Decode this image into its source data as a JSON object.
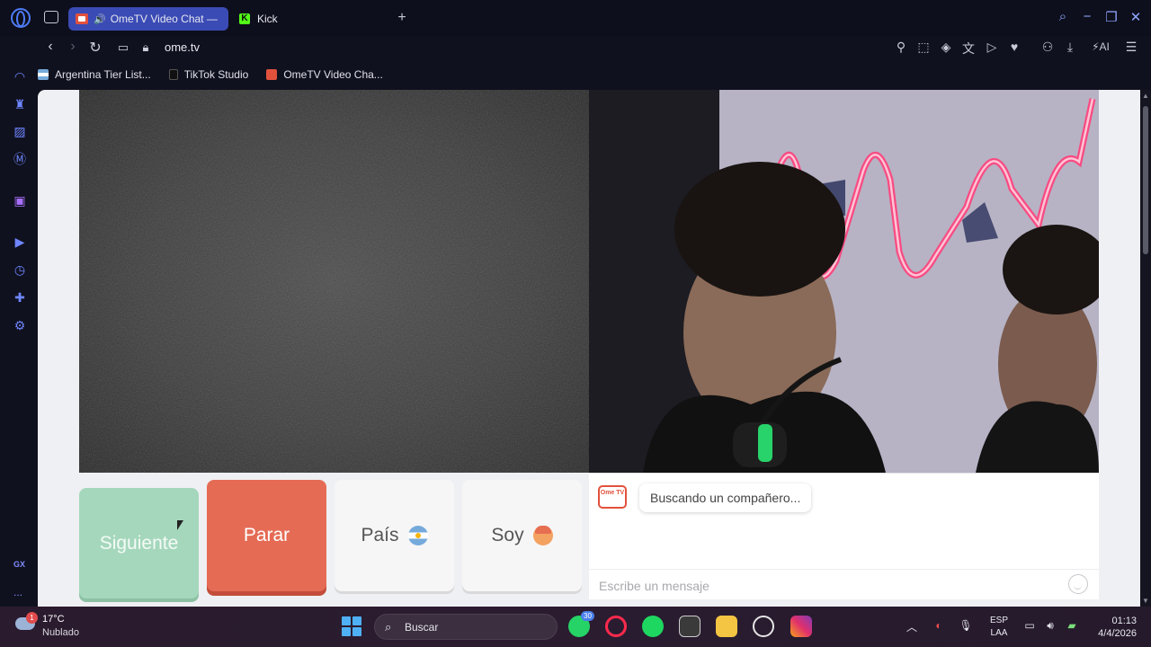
{
  "browser": {
    "tabs": [
      {
        "label": "OmeTV Video Chat —",
        "active": true
      },
      {
        "label": "Kick",
        "active": false
      }
    ],
    "url": "ome.tv",
    "ai_label": "AI",
    "bookmarks": [
      {
        "label": "Argentina Tier List...",
        "icon": "flag-icon"
      },
      {
        "label": "TikTok Studio",
        "icon": "tiktok-icon"
      },
      {
        "label": "OmeTV Video Cha...",
        "icon": "ometv-icon"
      }
    ],
    "sidebar_gx_label": "GX",
    "sidebar_more_label": "..."
  },
  "page": {
    "buttons": {
      "next": "Siguiente",
      "stop": "Parar",
      "country": "País",
      "gender": "Soy"
    },
    "logo_text": "Ome TV",
    "status_message": "Buscando un compañero...",
    "message_placeholder": "Escribe un mensaje",
    "colors": {
      "accent_stop": "#e56b55",
      "accent_next": "#a5d7bc"
    }
  },
  "taskbar": {
    "weather": {
      "badge": "1",
      "temp": "17°C",
      "desc": "Nublado"
    },
    "search_placeholder": "Buscar",
    "whatsapp_badge": "30",
    "lang": {
      "line1": "ESP",
      "line2": "LAA"
    },
    "clock": {
      "time": "01:13",
      "date": "4/4/2026"
    }
  }
}
